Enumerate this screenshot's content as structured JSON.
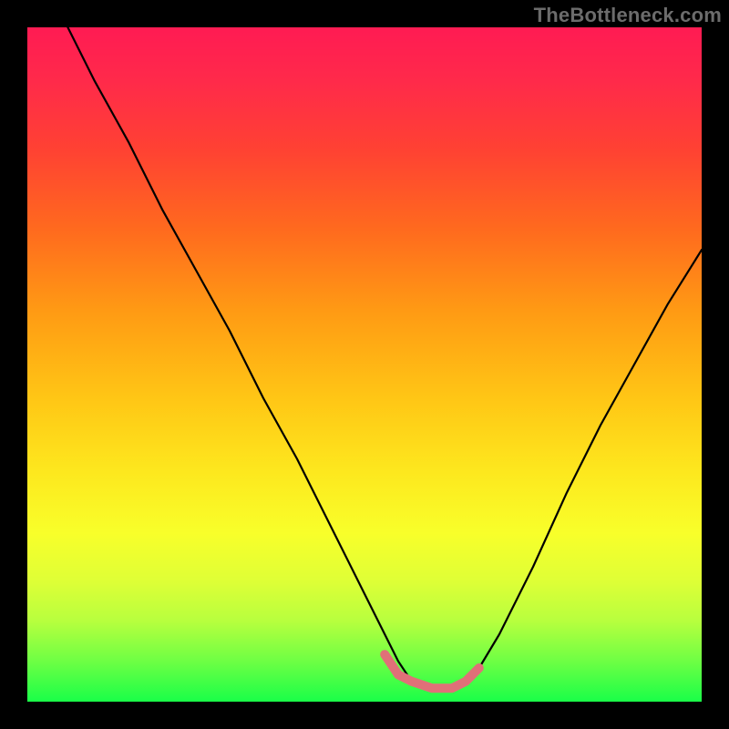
{
  "watermark": "TheBottleneck.com",
  "chart_data": {
    "type": "line",
    "title": "",
    "xlabel": "",
    "ylabel": "",
    "xlim": [
      0,
      100
    ],
    "ylim": [
      0,
      100
    ],
    "series": [
      {
        "name": "black-curve",
        "color": "#000000",
        "x": [
          6,
          10,
          15,
          20,
          25,
          30,
          35,
          40,
          45,
          50,
          53,
          55,
          57,
          60,
          63,
          65,
          67,
          70,
          75,
          80,
          85,
          90,
          95,
          100
        ],
        "values": [
          100,
          92,
          83,
          73,
          64,
          55,
          45,
          36,
          26,
          16,
          10,
          6,
          3,
          2,
          2,
          3,
          5,
          10,
          20,
          31,
          41,
          50,
          59,
          67
        ]
      },
      {
        "name": "pink-valley-highlight",
        "color": "#e07078",
        "x": [
          53,
          55,
          57,
          60,
          63,
          65,
          67
        ],
        "values": [
          7,
          4,
          3,
          2,
          2,
          3,
          5
        ]
      }
    ],
    "background_gradient_stops": [
      {
        "pos": 0,
        "color": "#ff1b53"
      },
      {
        "pos": 18,
        "color": "#ff4133"
      },
      {
        "pos": 42,
        "color": "#ff9a14"
      },
      {
        "pos": 66,
        "color": "#fde81e"
      },
      {
        "pos": 88,
        "color": "#b8ff3e"
      },
      {
        "pos": 100,
        "color": "#19ff48"
      }
    ]
  }
}
